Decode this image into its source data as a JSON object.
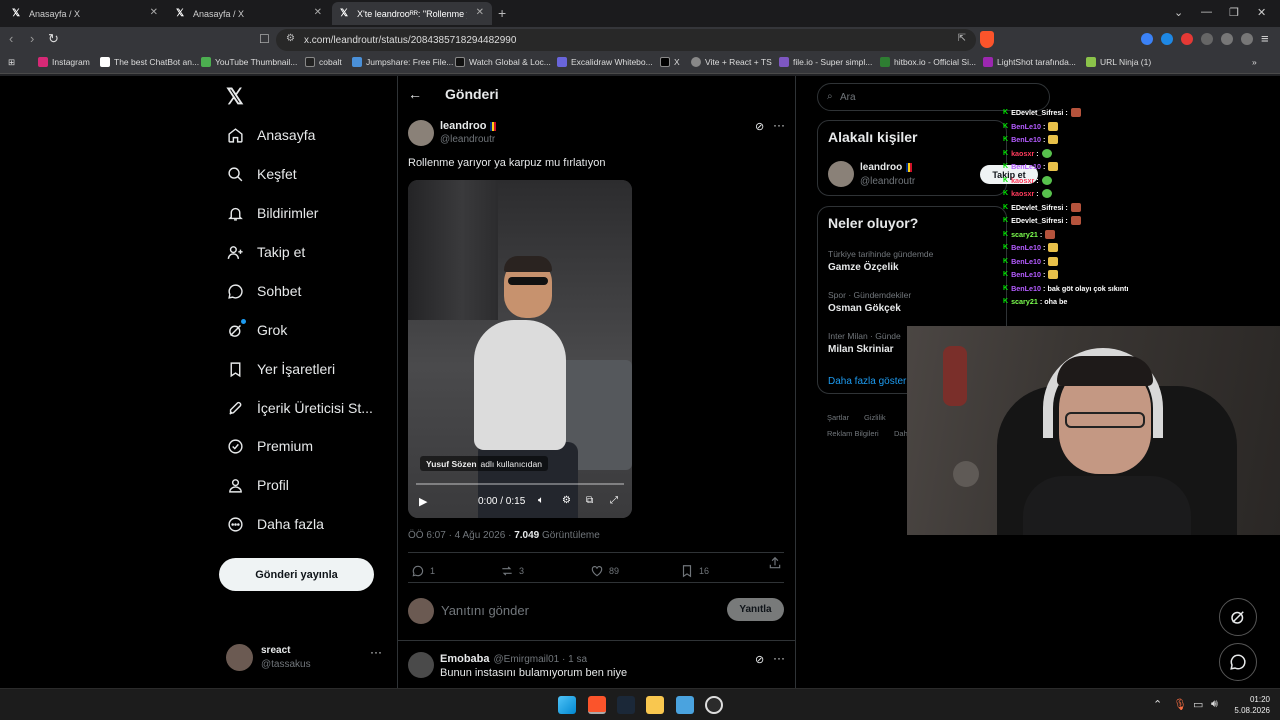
{
  "browser": {
    "tabs": [
      {
        "label": "Anasayfa / X"
      },
      {
        "label": "Anasayfa / X"
      },
      {
        "label": "X'te leandrooᴿᴿ: \"Rollenme ya"
      }
    ],
    "url": "x.com/leandroutr/status/2084385718294482990",
    "bookmarks": [
      "Instagram",
      "The best ChatBot an...",
      "YouTube Thumbnail...",
      "cobalt",
      "Jumpshare: Free File...",
      "Watch Global & Loc...",
      "Excalidraw Whitebo...",
      "X",
      "Vite + React + TS",
      "file.io - Super simpl...",
      "hitbox.io - Official Si...",
      "LightShot tarafında...",
      "URL Ninja (1)"
    ]
  },
  "sidebar": {
    "items": [
      {
        "label": "Anasayfa",
        "icon": "home-icon"
      },
      {
        "label": "Keşfet",
        "icon": "search-icon"
      },
      {
        "label": "Bildirimler",
        "icon": "bell-icon"
      },
      {
        "label": "Takip et",
        "icon": "follow-icon"
      },
      {
        "label": "Sohbet",
        "icon": "chat-icon"
      },
      {
        "label": "Grok",
        "icon": "grok-icon"
      },
      {
        "label": "Yer İşaretleri",
        "icon": "bookmark-icon"
      },
      {
        "label": "İçerik Üreticisi St...",
        "icon": "rocket-icon"
      },
      {
        "label": "Premium",
        "icon": "verified-icon"
      },
      {
        "label": "Profil",
        "icon": "profile-icon"
      },
      {
        "label": "Daha fazla",
        "icon": "more-circle-icon"
      }
    ],
    "post_button": "Gönderi yayınla",
    "account": {
      "name": "sreact",
      "handle": "@tassakus"
    }
  },
  "post": {
    "header_title": "Gönderi",
    "author_name": "leandroo",
    "author_handle": "@leandroutr",
    "text": "Rollenme yarıyor ya karpuz mu fırlatıyon",
    "video": {
      "caption_user": "Yusuf Sözen",
      "caption_suffix": "adlı kullanıcıdan",
      "time": "0:00 / 0:15",
      "progress": 0.0
    },
    "timestamp": "ÖÖ 6:07 · 4 Ağu 2026 ·",
    "views_count": "7.049",
    "views_label": "Görüntüleme",
    "stats": {
      "replies": "1",
      "reposts": "3",
      "likes": "89",
      "bookmarks": "16"
    },
    "reply_placeholder": "Yanıtını gönder",
    "reply_button": "Yanıtla"
  },
  "comment": {
    "name": "Emobaba",
    "handle": "@Emirgmail01 · 1 sa",
    "text": "Bunun instasını bulamıyorum ben niye"
  },
  "right": {
    "search_placeholder": "Ara",
    "related_title": "Alakalı kişiler",
    "related_name": "leandroo",
    "related_handle": "@leandroutr",
    "follow_button": "Takip et",
    "trends_title": "Neler oluyor?",
    "trends": [
      {
        "category": "Türkiye tarihinde gündemde",
        "name": "Gamze Özçelik"
      },
      {
        "category": "Spor · Gündemdekiler",
        "name": "Osman Gökçek"
      },
      {
        "category": "Inter Milan · Günde",
        "name": "Milan Skriniar"
      }
    ],
    "show_more": "Daha fazla göster",
    "footer": [
      "Şartlar",
      "Gizlilik",
      "Reklam Bilgileri",
      "Dah"
    ]
  },
  "chat": {
    "lines": [
      {
        "user": "EDevlet_Sifresi",
        "color": "#ffffff",
        "msg": "",
        "emote": "#b5533c"
      },
      {
        "user": "BenLe10",
        "color": "#b45cff",
        "msg": "",
        "emote": "#e8c14a"
      },
      {
        "user": "BenLe10",
        "color": "#b45cff",
        "msg": "",
        "emote": "#e8c14a"
      },
      {
        "user": "kaosxr",
        "color": "#ff3b5c",
        "msg": "",
        "emote": "#58c24d"
      },
      {
        "user": "BenLe10",
        "color": "#b45cff",
        "msg": "",
        "emote": "#e8c14a"
      },
      {
        "user": "kaosxr",
        "color": "#ff3b5c",
        "msg": "",
        "emote": "#58c24d"
      },
      {
        "user": "kaosxr",
        "color": "#ff3b5c",
        "msg": "",
        "emote": "#58c24d"
      },
      {
        "user": "EDevlet_Sifresi",
        "color": "#ffffff",
        "msg": "",
        "emote": "#b5533c"
      },
      {
        "user": "EDevlet_Sifresi",
        "color": "#ffffff",
        "msg": "",
        "emote": "#b5533c"
      },
      {
        "user": "scary21",
        "color": "#7cff4f",
        "msg": "",
        "emote": "#b5533c"
      },
      {
        "user": "BenLe10",
        "color": "#b45cff",
        "msg": "",
        "emote": "#e8c14a"
      },
      {
        "user": "BenLe10",
        "color": "#b45cff",
        "msg": "",
        "emote": "#e8c14a"
      },
      {
        "user": "BenLe10",
        "color": "#b45cff",
        "msg": "",
        "emote": "#e8c14a"
      },
      {
        "user": "BenLe10",
        "color": "#b45cff",
        "msg": "bak göt olayı çok sıkıntı",
        "emote": ""
      },
      {
        "user": "scary21",
        "color": "#7cff4f",
        "msg": "oha be",
        "emote": ""
      }
    ]
  },
  "taskbar": {
    "time": "01:20",
    "date": "5.08.2026"
  }
}
